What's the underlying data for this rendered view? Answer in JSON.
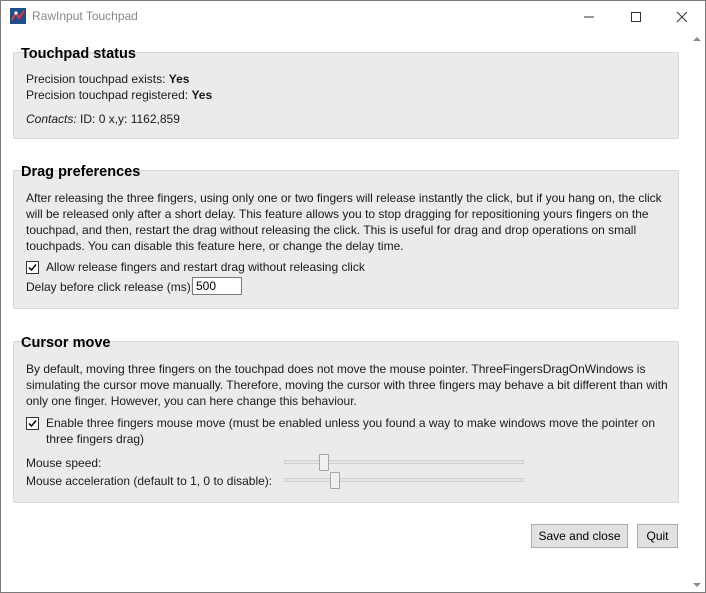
{
  "window": {
    "title": "RawInput Touchpad"
  },
  "status": {
    "title": "Touchpad status",
    "exists_label": "Precision touchpad exists:",
    "exists_value": "Yes",
    "registered_label": "Precision touchpad registered:",
    "registered_value": "Yes",
    "contacts_label": "Contacts:",
    "contacts_value": "ID: 0 x,y: 1162,859"
  },
  "drag": {
    "title": "Drag preferences",
    "description": "After releasing the three fingers, using only one or two fingers will release instantly the click, but if you hang on, the click will be released only after a short delay. This feature allows you to stop dragging for repositioning yours fingers on the touchpad, and then, restart the drag without releasing the click. This is useful for drag and drop operations on small touchpads. You can disable this feature here, or change the delay time.",
    "checkbox_label": "Allow release fingers and restart drag without releasing click",
    "checkbox_checked": true,
    "delay_label": "Delay before click release (ms):",
    "delay_value": "500"
  },
  "cursor": {
    "title": "Cursor move",
    "description": "By default, moving three fingers on the touchpad does not move the mouse pointer. ThreeFingersDragOnWindows is simulating the cursor move manually. Therefore, moving the cursor with three fingers may behave a bit different than with only one finger. However, you can here change this behaviour.",
    "checkbox_label_line1": "Enable three fingers mouse move (must be enabled unless you found a way to make windows move the pointer on",
    "checkbox_label_line2": "three fingers drag)",
    "checkbox_checked": true,
    "speed_label": "Mouse speed:",
    "speed_level": 0.15,
    "accel_label": "Mouse acceleration (default to 1, 0 to disable):",
    "accel_level": 0.2
  },
  "buttons": {
    "save": "Save and close",
    "quit": "Quit"
  }
}
